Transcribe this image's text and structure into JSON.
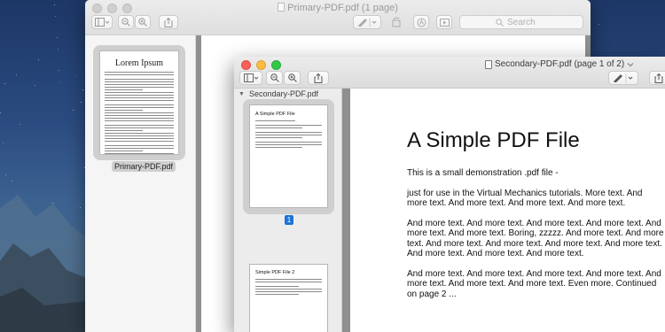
{
  "primary_window": {
    "title": "Primary-PDF.pdf (1 page)",
    "search_placeholder": "Search",
    "thumbnail": {
      "title": "Lorem Ipsum",
      "label": "Primary-PDF.pdf"
    }
  },
  "secondary_window": {
    "title": "Secondary-PDF.pdf (page 1 of 2)",
    "sidebar_header": "Secondary-PDF.pdf",
    "thumbnails": [
      {
        "title": "A Simple PDF File",
        "page_number": "1"
      },
      {
        "title": "Simple PDF File 2"
      }
    ],
    "page": {
      "heading": "A Simple PDF File",
      "paragraphs": [
        "This is a small demonstration .pdf file -",
        "just for use in the Virtual Mechanics tutorials. More text. And more text. And more text. And more text. And more text.",
        "And more text. And more text. And more text. And more text. And more text. And more text. Boring, zzzzz. And more text. And more text. And more text. And more text. And more text. And more text. And more text. And more text. And more text.",
        "And more text. And more text. And more text. And more text. And more text. And more text. And more text. Even more. Continued on page 2 ..."
      ]
    }
  },
  "colors": {
    "selection_blue": "#1f73d9",
    "close": "#fc605b",
    "minimize": "#fdbc40",
    "zoom": "#34c84a"
  }
}
